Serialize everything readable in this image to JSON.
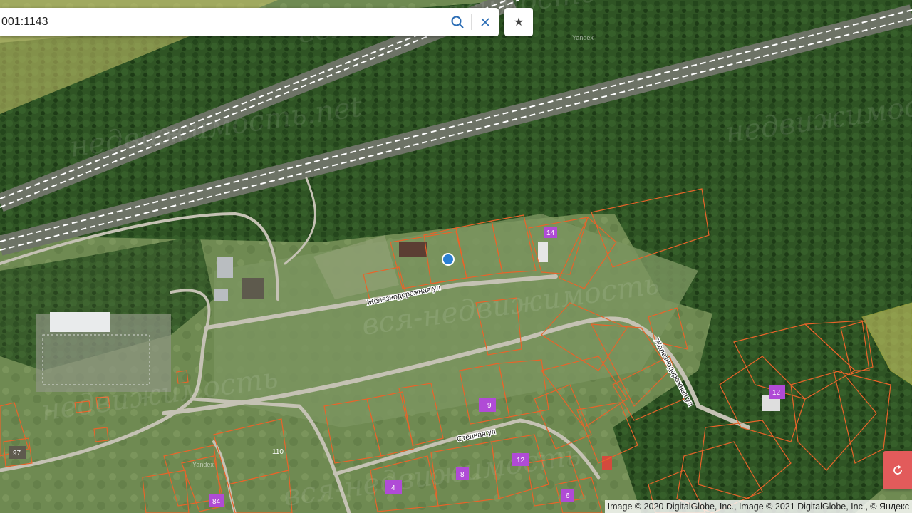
{
  "search": {
    "value": "001:1143"
  },
  "icons": {
    "search": "search-icon",
    "clear": "close-icon",
    "favorite": "star-icon",
    "reset": "refresh-icon"
  },
  "favorite_glyph": "★",
  "attribution": "Image © 2020 DigitalGlobe, Inc., Image © 2021 DigitalGlobe, Inc., © Яндекс",
  "streets": [
    {
      "name": "Железнодорожная ул"
    },
    {
      "name": "Железнодорожная ул"
    },
    {
      "name": "Степная ул"
    }
  ],
  "plots": [
    {
      "number": "14"
    },
    {
      "number": "9"
    },
    {
      "number": "12"
    },
    {
      "number": "8"
    },
    {
      "number": "4"
    },
    {
      "number": "6"
    },
    {
      "number": "12"
    },
    {
      "number": "110"
    },
    {
      "number": "97"
    },
    {
      "number": "84"
    }
  ],
  "watermarks": [
    {
      "text": "недвижимость.net"
    },
    {
      "text": "вся-недвижимость"
    },
    {
      "text": "вся-недвижимость"
    },
    {
      "text": "недвижимость"
    },
    {
      "text": "недвижимость"
    },
    {
      "text": "вся-недвижимость"
    }
  ],
  "map_tiles_label": "Yandex",
  "colors": {
    "parcel_border": "#e8642a",
    "zone_fill": "#d9d36a",
    "building_marker": "#b04bd6",
    "location_marker": "#2a7fd4",
    "reset_button": "#e25b5b"
  }
}
